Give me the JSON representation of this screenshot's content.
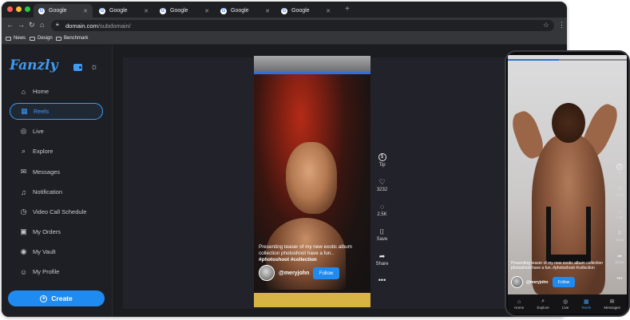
{
  "browser": {
    "tabs": [
      {
        "title": "Google",
        "favicon": "G",
        "active": true
      },
      {
        "title": "Google",
        "favicon": "G",
        "active": false
      },
      {
        "title": "Google",
        "favicon": "G",
        "active": false
      },
      {
        "title": "Google",
        "favicon": "G",
        "active": false
      },
      {
        "title": "Google",
        "favicon": "G",
        "active": false
      }
    ],
    "url_domain": "domain.com",
    "url_path": "/subdomain/",
    "bookmarks": [
      "News",
      "Design",
      "Benchmark"
    ]
  },
  "sidebar": {
    "logo": "Fanzly",
    "items": [
      {
        "label": "Home",
        "icon": "home-icon",
        "glyph": "⌂"
      },
      {
        "label": "Reels",
        "icon": "reels-icon",
        "glyph": "▦",
        "active": true
      },
      {
        "label": "Live",
        "icon": "live-icon",
        "glyph": "◎"
      },
      {
        "label": "Explore",
        "icon": "search-icon",
        "glyph": "⌕"
      },
      {
        "label": "Messages",
        "icon": "mail-icon",
        "glyph": "✉"
      },
      {
        "label": "Notification",
        "icon": "bell-icon",
        "glyph": "♫"
      },
      {
        "label": "Video Call Schedule",
        "icon": "video-call-icon",
        "glyph": "◷"
      },
      {
        "label": "My Orders",
        "icon": "bag-icon",
        "glyph": "▣"
      },
      {
        "label": "My Vault",
        "icon": "vault-icon",
        "glyph": "◉"
      },
      {
        "label": "My Profile",
        "icon": "user-icon",
        "glyph": "☺"
      }
    ],
    "create_label": "Create"
  },
  "reel": {
    "caption": "Presenting teaser of my new exotic album collection photoshoot have a fun..",
    "tags": "#photoshoot #collection",
    "username": "@meryjohn",
    "follow_label": "Follow",
    "actions": [
      {
        "label": "Tip",
        "icon": "tip-icon",
        "glyph": "$"
      },
      {
        "label": "3232",
        "icon": "heart-icon",
        "glyph": "♡"
      },
      {
        "label": "2.5K",
        "icon": "comment-icon",
        "glyph": "◌"
      },
      {
        "label": "Save",
        "icon": "bookmark-icon",
        "glyph": "⌷"
      },
      {
        "label": "Share",
        "icon": "share-icon",
        "glyph": "➦"
      },
      {
        "label": "",
        "icon": "more-icon",
        "glyph": "•••"
      }
    ]
  },
  "phone": {
    "caption": "Presenting teaser of my new exotic album collection photoshoot have a fun..#photoshoot #collection",
    "username": "@meryjohn",
    "follow_label": "Follow",
    "actions": [
      {
        "label": "Tip",
        "icon": "tip-icon",
        "glyph": "$"
      },
      {
        "label": "3232",
        "icon": "heart-icon",
        "glyph": "♡"
      },
      {
        "label": "2.5K",
        "icon": "comment-icon",
        "glyph": "◌"
      },
      {
        "label": "Save",
        "icon": "bookmark-icon",
        "glyph": "⌷"
      },
      {
        "label": "Share",
        "icon": "share-icon",
        "glyph": "➦"
      },
      {
        "label": "",
        "icon": "more-icon",
        "glyph": "•••"
      }
    ],
    "tabbar": [
      {
        "label": "Home",
        "icon": "home-icon",
        "glyph": "⌂"
      },
      {
        "label": "Explore",
        "icon": "search-icon",
        "glyph": "⌕"
      },
      {
        "label": "Live",
        "icon": "live-icon",
        "glyph": "◎"
      },
      {
        "label": "Reels",
        "icon": "reels-icon",
        "glyph": "▦",
        "active": true
      },
      {
        "label": "Messages",
        "icon": "mail-icon",
        "glyph": "✉"
      }
    ]
  },
  "colors": {
    "accent": "#1f8bf0",
    "sidebar_bg": "#1e1f24",
    "content_bg": "#22232a"
  }
}
